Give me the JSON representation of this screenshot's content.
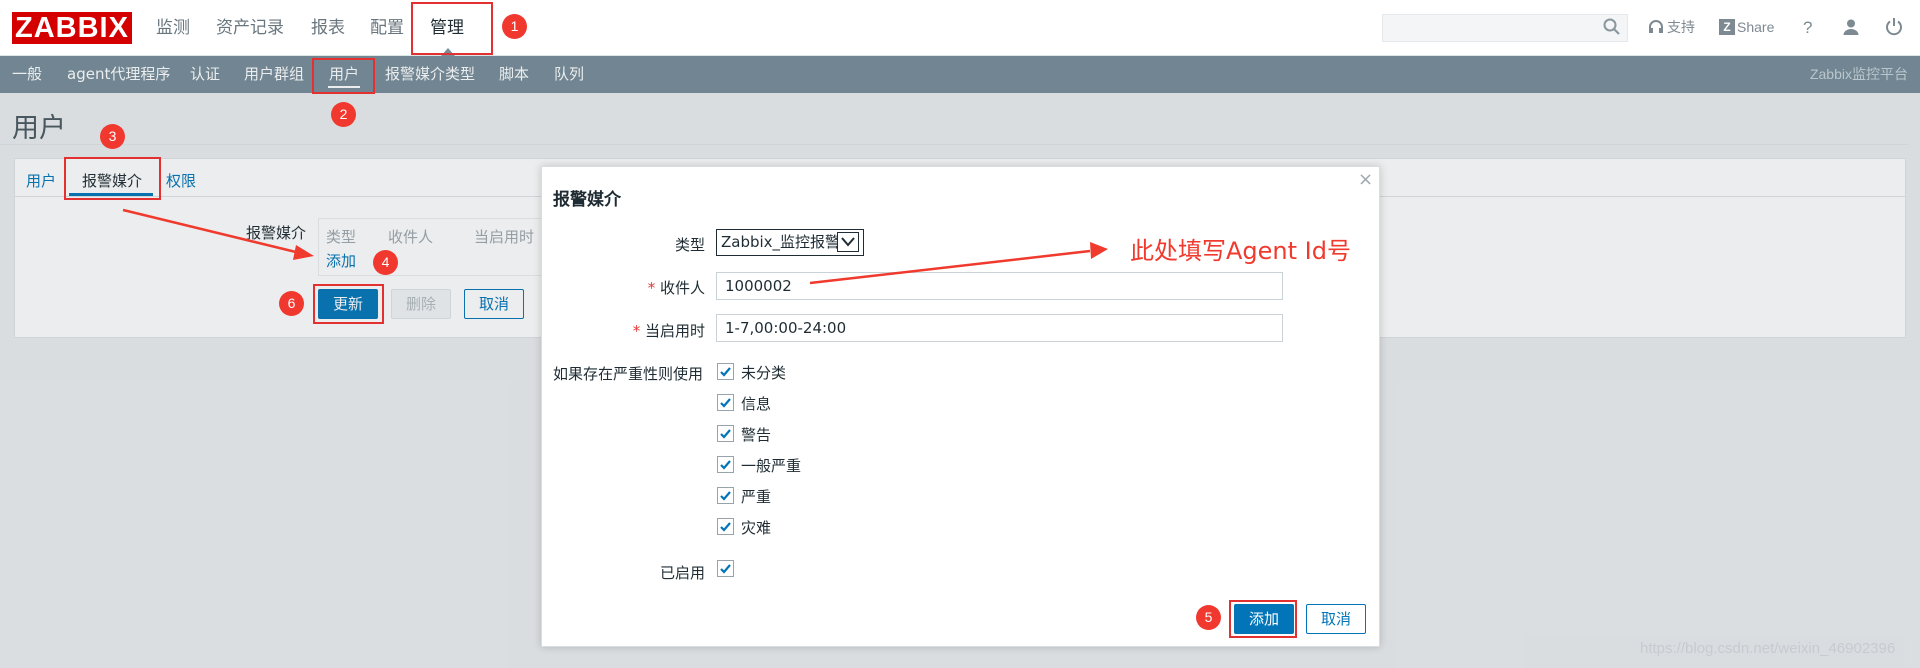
{
  "header": {
    "logo": "ZABBIX",
    "nav": [
      "监测",
      "资产记录",
      "报表",
      "配置",
      "管理"
    ],
    "support_label": "支持",
    "share_label": "Share",
    "help_label": "?"
  },
  "subnav": {
    "items": [
      "一般",
      "agent代理程序",
      "认证",
      "用户群组",
      "用户",
      "报警媒介类型",
      "脚本",
      "队列"
    ],
    "brand": "Zabbix监控平台"
  },
  "page": {
    "title": "用户",
    "tabs": [
      "用户",
      "报警媒介",
      "权限"
    ],
    "media_label": "报警媒介",
    "media_columns": [
      "类型",
      "收件人",
      "当启用时"
    ],
    "add_link": "添加",
    "buttons": {
      "update": "更新",
      "delete": "删除",
      "cancel": "取消"
    }
  },
  "dialog": {
    "title": "报警媒介",
    "close": "×",
    "type_label": "类型",
    "type_value": "Zabbix_监控报警",
    "sendto_label": "收件人",
    "sendto_value": "1000002",
    "period_label": "当启用时",
    "period_value": "1-7,00:00-24:00",
    "severity_label": "如果存在严重性则使用",
    "severities": [
      "未分类",
      "信息",
      "警告",
      "一般严重",
      "严重",
      "灾难"
    ],
    "enabled_label": "已启用",
    "required_mark": "*",
    "add_button": "添加",
    "cancel_button": "取消"
  },
  "annotations": {
    "markers": [
      "1",
      "2",
      "3",
      "4",
      "5",
      "6"
    ],
    "note": "此处填写Agent Id号",
    "color": "#e33030"
  },
  "watermark": "https://blog.csdn.net/weixin_46902396"
}
